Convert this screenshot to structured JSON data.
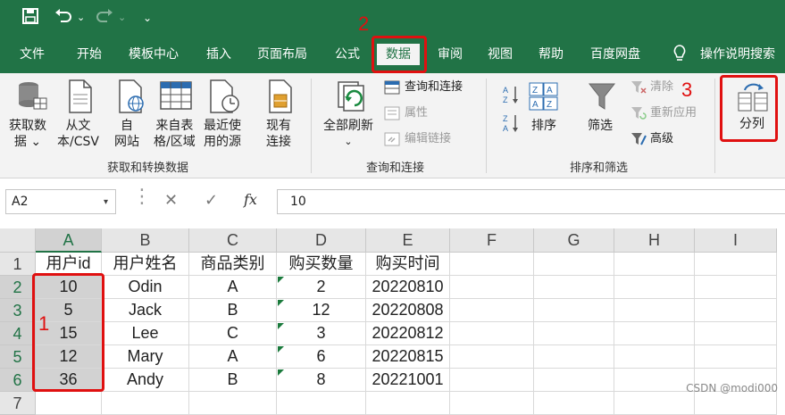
{
  "titlebar": {
    "qat_dropdown": "⌄"
  },
  "tabs": [
    "文件",
    "开始",
    "模板中心",
    "插入",
    "页面布局",
    "公式",
    "数据",
    "审阅",
    "视图",
    "帮助",
    "百度网盘"
  ],
  "tell_me": "操作说明搜索",
  "ribbon": {
    "get_data": {
      "l1": "获取数",
      "l2": "据 ⌄"
    },
    "from_csv": {
      "l1": "从文",
      "l2": "本/CSV"
    },
    "from_web": {
      "l1": "自",
      "l2": "网站"
    },
    "from_table": {
      "l1": "来自表",
      "l2": "格/区域"
    },
    "recent_sources": {
      "l1": "最近使",
      "l2": "用的源"
    },
    "existing_conn": {
      "l1": "现有",
      "l2": "连接"
    },
    "group1": "获取和转换数据",
    "refresh_all": {
      "l1": "全部刷新",
      "l2": "⌄"
    },
    "queries_conn": "查询和连接",
    "properties": "属性",
    "edit_links": "编辑链接",
    "group2": "查询和连接",
    "sort": "排序",
    "filter": "筛选",
    "clear": "清除",
    "reapply": "重新应用",
    "advanced": "高级",
    "group3": "排序和筛选",
    "text_to_columns": "分列"
  },
  "formula_bar": {
    "name_box": "A2",
    "cancel": "✕",
    "enter": "✓",
    "fx": "fx",
    "value": "10"
  },
  "columns": [
    "A",
    "B",
    "C",
    "D",
    "E",
    "F",
    "G",
    "H",
    "I"
  ],
  "rows": [
    [
      "用户id",
      "用户姓名",
      "商品类别",
      "购买数量",
      "购买时间"
    ],
    [
      "10",
      "Odin",
      "A",
      "2",
      "20220810"
    ],
    [
      "5",
      "Jack",
      "B",
      "12",
      "20220808"
    ],
    [
      "15",
      "Lee",
      "C",
      "3",
      "20220812"
    ],
    [
      "12",
      "Mary",
      "A",
      "6",
      "20220815"
    ],
    [
      "36",
      "Andy",
      "B",
      "8",
      "20221001"
    ],
    [
      "",
      "",
      "",
      "",
      ""
    ]
  ],
  "row_numbers": [
    "1",
    "2",
    "3",
    "4",
    "5",
    "6",
    "7"
  ],
  "annotations": {
    "n1": "1",
    "n2": "2",
    "n3": "3"
  },
  "watermark": "CSDN @modi000",
  "colors": {
    "excel_green": "#217346",
    "annotation_red": "#e01010"
  }
}
